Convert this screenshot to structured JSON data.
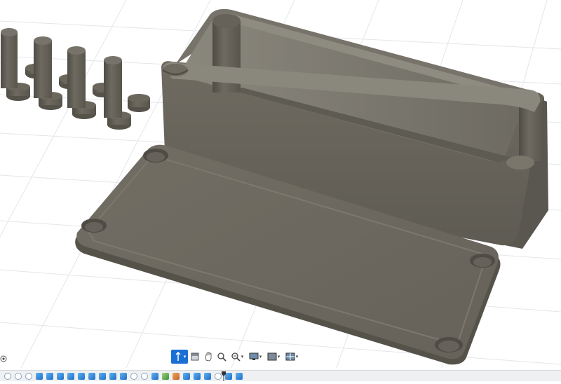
{
  "viewport": {
    "background": "#ffffff",
    "grid_color": "#e3e6ea",
    "body_color": "#6b675d",
    "body_dark": "#55524a",
    "body_light": "#807c70"
  },
  "nav_toolbar": {
    "buttons": [
      {
        "icon": "orbit-icon",
        "active": true,
        "dropdown": true
      },
      {
        "icon": "look-at-icon",
        "active": false,
        "dropdown": false
      },
      {
        "icon": "pan-icon",
        "active": false,
        "dropdown": false
      },
      {
        "icon": "zoom-icon",
        "active": false,
        "dropdown": false
      },
      {
        "icon": "fit-zoom-icon",
        "active": false,
        "dropdown": true
      },
      {
        "icon": "display-settings-icon",
        "active": false,
        "dropdown": true
      },
      {
        "icon": "grid-snaps-icon",
        "active": false,
        "dropdown": true
      },
      {
        "icon": "viewports-icon",
        "active": false,
        "dropdown": true
      }
    ]
  },
  "timeline": {
    "items": [
      "sketch",
      "sketch",
      "sketch",
      "body",
      "body",
      "body",
      "body",
      "body",
      "body",
      "body",
      "body",
      "body",
      "sketch",
      "sketch",
      "body",
      "fillet",
      "shell",
      "body",
      "body",
      "body",
      "sketch",
      "body",
      "body"
    ],
    "colors": {
      "body": "#2b7ad0",
      "fillet": "#3f8f3a",
      "shell": "#c0642a"
    }
  }
}
